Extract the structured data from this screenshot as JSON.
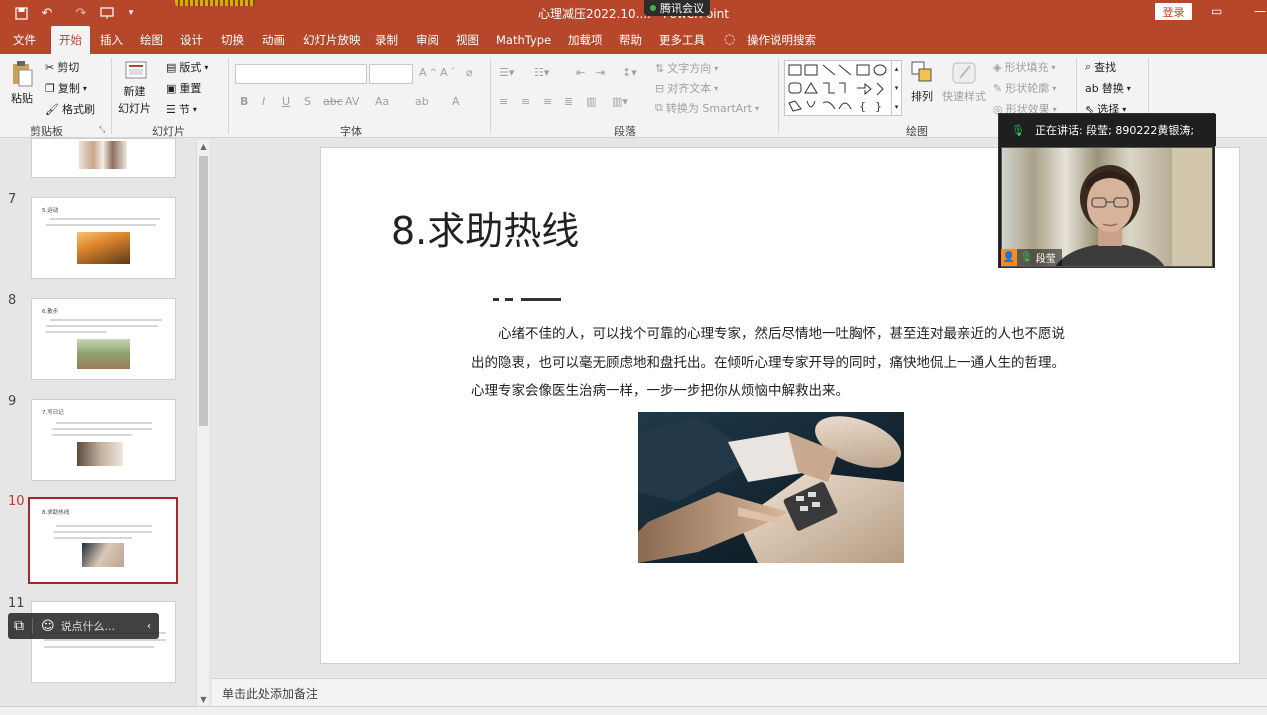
{
  "app": {
    "window_title": "心理减压2022.10.... - PowerPoint",
    "meeting_label": "腾讯会议",
    "login_label": "登录"
  },
  "tabs": [
    "文件",
    "开始",
    "插入",
    "绘图",
    "设计",
    "切换",
    "动画",
    "幻灯片放映",
    "录制",
    "审阅",
    "视图",
    "MathType",
    "加载项",
    "帮助",
    "更多工具"
  ],
  "tell_me": "操作说明搜索",
  "ribbon": {
    "clipboard": {
      "label": "剪贴板",
      "paste": "粘贴",
      "cut": "剪切",
      "copy": "复制",
      "format_painter": "格式刷"
    },
    "slides": {
      "label": "幻灯片",
      "new_slide_1": "新建",
      "new_slide_2": "幻灯片",
      "layout": "版式",
      "reset": "重置",
      "section": "节"
    },
    "font": {
      "label": "字体"
    },
    "paragraph": {
      "label": "段落",
      "text_direction": "文字方向",
      "align_text": "对齐文本",
      "smartart": "转换为 SmartArt"
    },
    "drawing": {
      "label": "绘图",
      "arrange": "排列",
      "quick_styles": "快速样式",
      "shape_fill": "形状填充",
      "shape_outline": "形状轮廓",
      "shape_effects": "形状效果"
    },
    "editing": {
      "find": "查找",
      "replace": "替换",
      "select": "选择"
    }
  },
  "thumbnails": [
    {
      "num": "7",
      "title": "5.运动"
    },
    {
      "num": "8",
      "title": "6.散步"
    },
    {
      "num": "9",
      "title": "7.写日记"
    },
    {
      "num": "10",
      "title": "8.求助热线"
    },
    {
      "num": "11",
      "title": ""
    }
  ],
  "chat": {
    "placeholder": "说点什么..."
  },
  "slide": {
    "title": "8.求助热线",
    "body": "心绪不佳的人，可以找个可靠的心理专家，然后尽情地一吐胸怀，甚至连对最亲近的人也不愿说出的隐衷，也可以毫无顾虑地和盘托出。在倾听心理专家开导的同时，痛快地侃上一通人生的哲理。心理专家会像医生治病一样，一步一步把你从烦恼中解救出来。"
  },
  "video": {
    "speaking": "正在讲话: 段莹; 890222黄银涛;",
    "name": "段莹"
  },
  "notes": {
    "placeholder": "单击此处添加备注"
  }
}
